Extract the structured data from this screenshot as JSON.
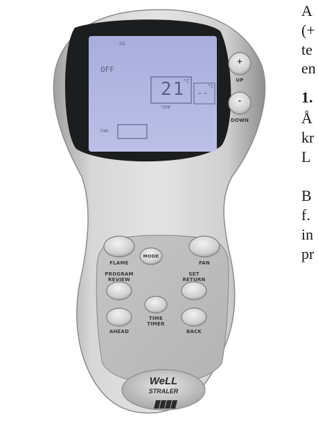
{
  "page_text_fragments": [
    "A",
    "(+",
    "te",
    "en",
    "1.",
    "Å",
    "kr",
    "L",
    "B",
    "f.",
    "in",
    "pr"
  ],
  "lcd": {
    "indicator_top": "SU",
    "mode_text": "OFF",
    "set_temp": "21",
    "set_unit": "°C",
    "room_temp": "--",
    "room_unit": "°C",
    "temp_label": "TEMP",
    "fan_label": "FAN"
  },
  "buttons": {
    "up_symbol": "+",
    "up_label": "UP",
    "down_symbol": "-",
    "down_label": "DOWN",
    "flame_label": "FLAME",
    "fan_label": "FAN",
    "mode_label": "MODE",
    "program_review_label_1": "PROGRAM",
    "program_review_label_2": "REVIEW",
    "set_return_label_1": "SET",
    "set_return_label_2": "RETURN",
    "time_timer_label_1": "TIME",
    "time_timer_label_2": "TIMER",
    "ahead_label": "AHEAD",
    "back_label": "BACK"
  },
  "logo": {
    "line1": "WeLL",
    "line2": "STRALER"
  },
  "colors": {
    "body_silver": "#c9cac9",
    "lcd_blue": "#b3b7df",
    "bezel": "#1b1d1f"
  }
}
